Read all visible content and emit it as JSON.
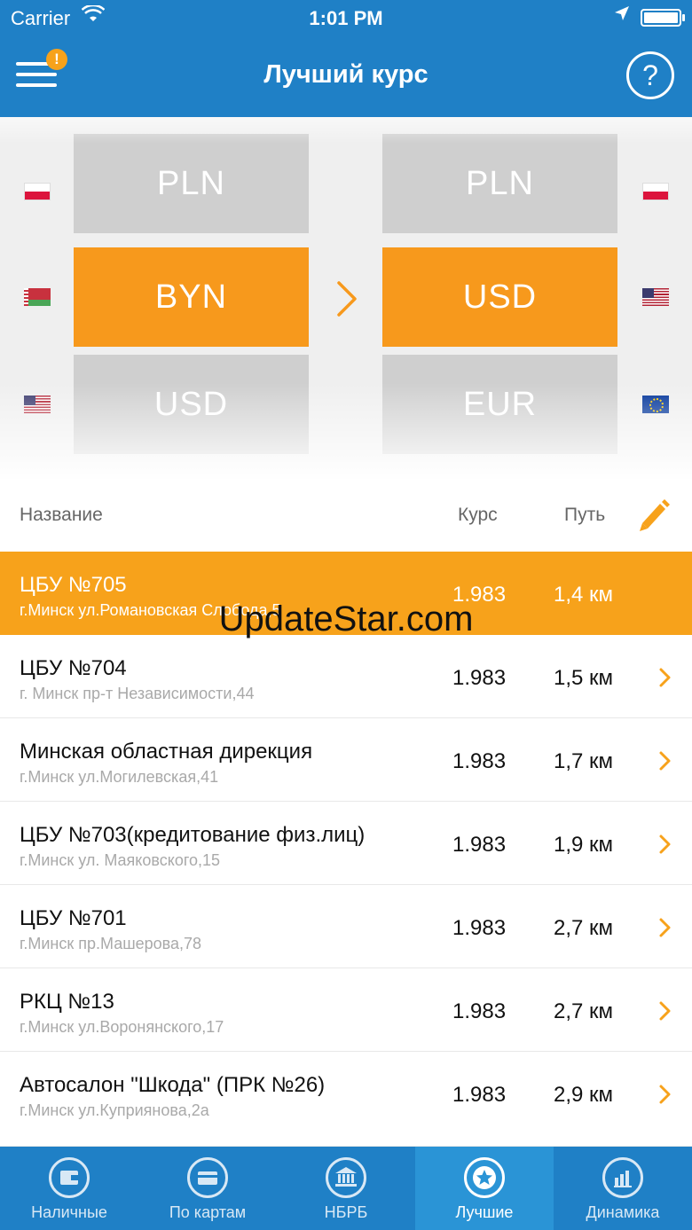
{
  "status_bar": {
    "carrier": "Carrier",
    "time": "1:01 PM"
  },
  "header": {
    "title": "Лучший курс",
    "alert_badge": "!",
    "help_label": "?"
  },
  "picker": {
    "from": [
      "PLN",
      "BYN",
      "USD"
    ],
    "to": [
      "PLN",
      "USD",
      "EUR"
    ],
    "from_selected": "BYN",
    "to_selected": "USD",
    "from_flags": [
      "poland-flag-icon",
      "belarus-flag-icon",
      "usa-flag-icon"
    ],
    "to_flags": [
      "poland-flag-icon",
      "usa-flag-icon",
      "eu-flag-icon"
    ]
  },
  "columns": {
    "name": "Название",
    "rate": "Курс",
    "distance": "Путь"
  },
  "rows": [
    {
      "name": "ЦБУ №705",
      "address": "г.Минск ул.Романовская Слобода,5",
      "rate": "1.983",
      "distance": "1,4 км"
    },
    {
      "name": "ЦБУ №704",
      "address": "г. Минск пр-т Независимости,44",
      "rate": "1.983",
      "distance": "1,5 км"
    },
    {
      "name": "Минская областная дирекция",
      "address": "г.Минск ул.Могилевская,41",
      "rate": "1.983",
      "distance": "1,7 км"
    },
    {
      "name": "ЦБУ №703(кредитование физ.лиц)",
      "address": "г.Минск ул. Маяковского,15",
      "rate": "1.983",
      "distance": "1,9 км"
    },
    {
      "name": "ЦБУ №701",
      "address": "г.Минск пр.Машерова,78",
      "rate": "1.983",
      "distance": "2,7 км"
    },
    {
      "name": "РКЦ №13",
      "address": "г.Минск ул.Воронянского,17",
      "rate": "1.983",
      "distance": "2,7 км"
    },
    {
      "name": "Автосалон \"Шкода\" (ПРК №26)",
      "address": "г.Минск ул.Куприянова,2а",
      "rate": "1.983",
      "distance": "2,9 км"
    }
  ],
  "watermark": "UpdateStar.com",
  "tabs": [
    {
      "label": "Наличные",
      "icon": "wallet-icon"
    },
    {
      "label": "По картам",
      "icon": "card-icon"
    },
    {
      "label": "НБРБ",
      "icon": "bank-icon"
    },
    {
      "label": "Лучшие",
      "icon": "star-icon"
    },
    {
      "label": "Динамика",
      "icon": "chart-icon"
    }
  ],
  "colors": {
    "brand_blue": "#1f80c6",
    "accent_orange": "#f7991c",
    "active_tab": "#2a94d6"
  }
}
